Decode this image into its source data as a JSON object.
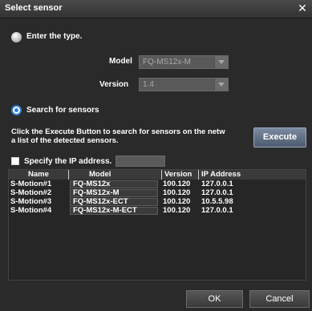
{
  "window": {
    "title": "Select sensor",
    "close_glyph": "✕"
  },
  "enter_type": {
    "label": "Enter the type.",
    "model_label": "Model",
    "model_value": "FQ-MS12x-M",
    "version_label": "Version",
    "version_value": "1.4"
  },
  "search": {
    "label": "Search for sensors",
    "description_line1": "Click the Execute Button to search for sensors on the netw",
    "description_line2": "a list of the detected sensors.",
    "execute_label": "Execute",
    "specify_ip_label": "Specify the IP address.",
    "ip_placeholder": ""
  },
  "table": {
    "columns": [
      "Name",
      "Model",
      "Version",
      "IP Address"
    ],
    "rows": [
      {
        "name": "S-Motion#1",
        "model": "FQ-MS12x",
        "version": "100.120",
        "ip": "127.0.0.1"
      },
      {
        "name": "S-Motion#2",
        "model": "FQ-MS12x-M",
        "version": "100.120",
        "ip": "127.0.0.1"
      },
      {
        "name": "S-Motion#3",
        "model": "FQ-MS12x-ECT",
        "version": "100.120",
        "ip": "10.5.5.98"
      },
      {
        "name": "S-Motion#4",
        "model": "FQ-MS12x-M-ECT",
        "version": "100.120",
        "ip": "127.0.0.1"
      }
    ]
  },
  "footer": {
    "ok_label": "OK",
    "cancel_label": "Cancel"
  }
}
